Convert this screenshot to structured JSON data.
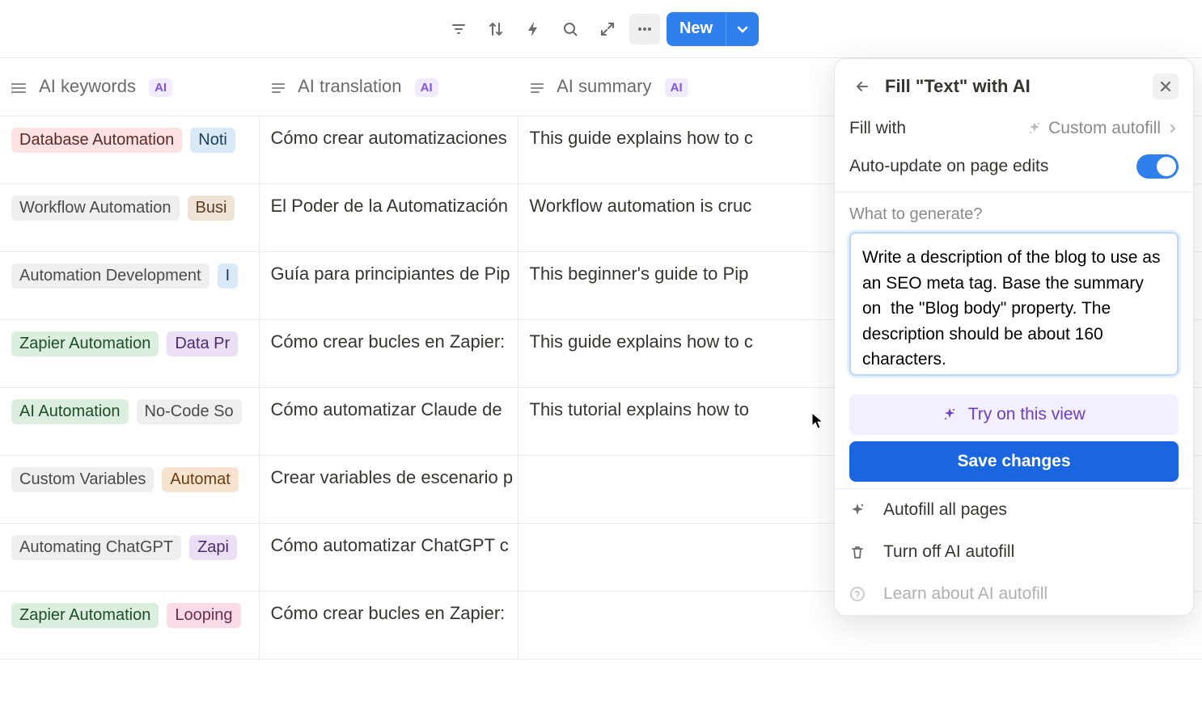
{
  "toolbar": {
    "new_label": "New"
  },
  "columns": {
    "ai_keywords": "AI keywords",
    "ai_translation": "AI translation",
    "ai_summary": "AI summary",
    "ai_badge": "AI"
  },
  "rows": [
    {
      "tags": [
        {
          "text": "Database Automation",
          "color": "red"
        },
        {
          "text": "Noti",
          "color": "blue"
        }
      ],
      "translation": "Cómo crear automatizaciones",
      "summary": "This guide explains how to c"
    },
    {
      "tags": [
        {
          "text": "Workflow Automation",
          "color": "gray"
        },
        {
          "text": "Busi",
          "color": "brown"
        }
      ],
      "translation": "El Poder de la Automatización",
      "summary": "Workflow automation is cruc"
    },
    {
      "tags": [
        {
          "text": "Automation Development",
          "color": "gray"
        },
        {
          "text": "I",
          "color": "blue"
        }
      ],
      "translation": "Guía para principiantes de Pip",
      "summary": "This beginner's guide to Pip"
    },
    {
      "tags": [
        {
          "text": "Zapier Automation",
          "color": "green"
        },
        {
          "text": "Data Pr",
          "color": "purple"
        }
      ],
      "translation": "Cómo crear bucles en Zapier:",
      "summary": "This guide explains how to c"
    },
    {
      "tags": [
        {
          "text": "AI Automation",
          "color": "green"
        },
        {
          "text": "No-Code So",
          "color": "gray"
        }
      ],
      "translation": "Cómo automatizar Claude de ",
      "summary": "This tutorial explains how to"
    },
    {
      "tags": [
        {
          "text": "Custom Variables",
          "color": "gray"
        },
        {
          "text": "Automat",
          "color": "orange"
        }
      ],
      "translation": "Crear variables de escenario p",
      "summary": ""
    },
    {
      "tags": [
        {
          "text": "Automating ChatGPT",
          "color": "gray"
        },
        {
          "text": "Zapi",
          "color": "purple"
        }
      ],
      "translation": "Cómo automatizar ChatGPT c",
      "summary": ""
    },
    {
      "tags": [
        {
          "text": "Zapier Automation",
          "color": "green"
        },
        {
          "text": "Looping",
          "color": "pink"
        }
      ],
      "translation": "Cómo crear bucles en Zapier:",
      "summary": ""
    }
  ],
  "panel": {
    "title": "Fill \"Text\" with AI",
    "fill_with_label": "Fill with",
    "fill_with_value": "Custom autofill",
    "auto_update_label": "Auto-update on page edits",
    "auto_update_on": true,
    "generate_label": "What to generate?",
    "prompt_value": "Write a description of the blog to use as an SEO meta tag. Base the summary on  the \"Blog body\" property. The description should be about 160 characters.",
    "try_label": "Try on this view",
    "save_label": "Save changes",
    "action_autofill": "Autofill all pages",
    "action_turnoff": "Turn off AI autofill",
    "action_learn": "Learn about AI autofill"
  }
}
